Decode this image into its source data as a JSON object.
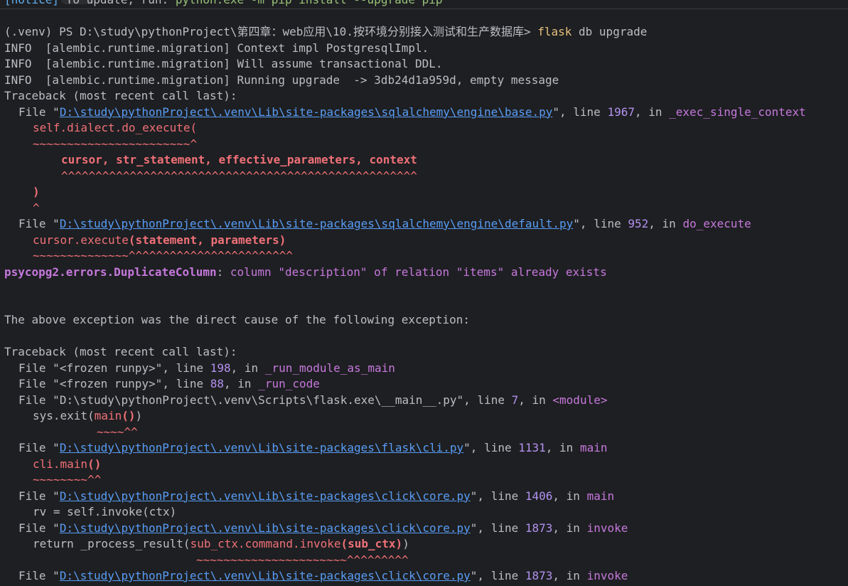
{
  "notice": {
    "tag": "[notice]",
    "text": " To update, run: ",
    "command": "python.exe -m pip install --upgrade pip"
  },
  "prompt": {
    "text": "(.venv) PS D:\\study\\pythonProject\\第四章：web应用\\10.按环境分别接入测试和生产数据库> ",
    "cmd": "flask",
    "args": " db upgrade"
  },
  "info": [
    "INFO  [alembic.runtime.migration] Context impl PostgresqlImpl.",
    "INFO  [alembic.runtime.migration] Will assume transactional DDL.",
    "INFO  [alembic.runtime.migration] Running upgrade  -> 3db24d1a959d, empty message"
  ],
  "traceback_header": "Traceback (most recent call last):",
  "tb1": [
    {
      "path": "D:\\study\\pythonProject\\.venv\\Lib\\site-packages\\sqlalchemy\\engine\\base.py",
      "line": "1967",
      "func": "_exec_single_context"
    },
    {
      "path": "D:\\study\\pythonProject\\.venv\\Lib\\site-packages\\sqlalchemy\\engine\\default.py",
      "line": "952",
      "func": "do_execute"
    }
  ],
  "code1": {
    "a": "self.dialect.do_execute(",
    "a_marker": "~~~~~~~~~~~~~~~~~~~~~~~^",
    "b": "cursor, str_statement, effective_parameters, context",
    "b_marker": "^^^^^^^^^^^^^^^^^^^^^^^^^^^^^^^^^^^^^^^^^^^^^^^^^^^^",
    "c": ")",
    "c_marker": "^",
    "d_pre": "cursor.execute",
    "d_bold": "(statement, parameters)",
    "d_marker": "~~~~~~~~~~~~~~^^^^^^^^^^^^^^^^^^^^^^^^"
  },
  "exception": {
    "name": "psycopg2.errors.DuplicateColumn",
    "message": "column \"description\" of relation \"items\" already exists"
  },
  "cause": "The above exception was the direct cause of the following exception:",
  "tb2": {
    "f1": {
      "file": "<frozen runpy>",
      "line": "198",
      "func": "_run_module_as_main"
    },
    "f2": {
      "file": "<frozen runpy>",
      "line": "88",
      "func": "_run_code"
    },
    "f3": {
      "file": "D:\\study\\pythonProject\\.venv\\Scripts\\flask.exe\\__main__.py",
      "line": "7",
      "func": "<module>"
    },
    "f3_code_pre": "sys.exit(",
    "f3_code_mid": "main",
    "f3_code_bold": "()",
    "f3_code_post": ")",
    "f3_marker": "~~~~^^",
    "f4": {
      "path": "D:\\study\\pythonProject\\.venv\\Lib\\site-packages\\flask\\cli.py",
      "line": "1131",
      "func": "main"
    },
    "f4_code_pre": "cli.main",
    "f4_code_bold": "()",
    "f4_marker": "~~~~~~~~^^",
    "f5": {
      "path": "D:\\study\\pythonProject\\.venv\\Lib\\site-packages\\click\\core.py",
      "line": "1406",
      "func": "main"
    },
    "f5_code": "rv = self.invoke(ctx)",
    "f6": {
      "path": "D:\\study\\pythonProject\\.venv\\Lib\\site-packages\\click\\core.py",
      "line": "1873",
      "func": "invoke"
    },
    "f6_code_pre": "return _process_result(",
    "f6_code_red": "sub_ctx.command.invoke",
    "f6_code_bold": "(sub_ctx)",
    "f6_code_post": ")",
    "f6_marker": "~~~~~~~~~~~~~~~~~~~~~~^^^^^^^^^",
    "f7": {
      "path": "D:\\study\\pythonProject\\.venv\\Lib\\site-packages\\click\\core.py",
      "line": "1873",
      "func": "invoke"
    }
  },
  "labels": {
    "file": "File ",
    "quote": "\"",
    "line_sep": ", line ",
    "in_sep": ", in "
  }
}
